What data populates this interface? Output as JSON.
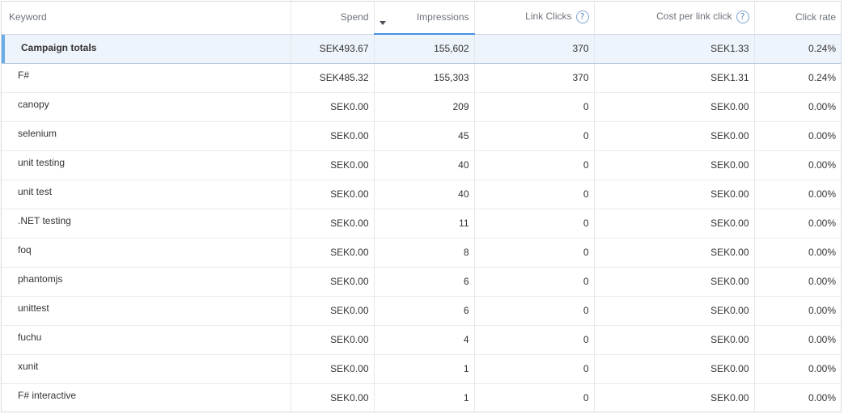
{
  "columns": {
    "keyword": "Keyword",
    "spend": "Spend",
    "impressions": "Impressions",
    "link_clicks": "Link Clicks",
    "cost_per_link_click": "Cost per link click",
    "click_rate": "Click rate"
  },
  "help_glyph": "?",
  "sorted_column": "impressions",
  "accent_color": "#4a90e2",
  "totals": {
    "keyword": "Campaign totals",
    "spend": "SEK493.67",
    "impressions": "155,602",
    "link_clicks": "370",
    "cost_per_link_click": "SEK1.33",
    "click_rate": "0.24%"
  },
  "rows": [
    {
      "keyword": "F#",
      "spend": "SEK485.32",
      "impressions": "155,303",
      "link_clicks": "370",
      "cost_per_link_click": "SEK1.31",
      "click_rate": "0.24%"
    },
    {
      "keyword": "canopy",
      "spend": "SEK0.00",
      "impressions": "209",
      "link_clicks": "0",
      "cost_per_link_click": "SEK0.00",
      "click_rate": "0.00%"
    },
    {
      "keyword": "selenium",
      "spend": "SEK0.00",
      "impressions": "45",
      "link_clicks": "0",
      "cost_per_link_click": "SEK0.00",
      "click_rate": "0.00%"
    },
    {
      "keyword": "unit testing",
      "spend": "SEK0.00",
      "impressions": "40",
      "link_clicks": "0",
      "cost_per_link_click": "SEK0.00",
      "click_rate": "0.00%"
    },
    {
      "keyword": "unit test",
      "spend": "SEK0.00",
      "impressions": "40",
      "link_clicks": "0",
      "cost_per_link_click": "SEK0.00",
      "click_rate": "0.00%"
    },
    {
      "keyword": ".NET testing",
      "spend": "SEK0.00",
      "impressions": "11",
      "link_clicks": "0",
      "cost_per_link_click": "SEK0.00",
      "click_rate": "0.00%"
    },
    {
      "keyword": "foq",
      "spend": "SEK0.00",
      "impressions": "8",
      "link_clicks": "0",
      "cost_per_link_click": "SEK0.00",
      "click_rate": "0.00%"
    },
    {
      "keyword": "phantomjs",
      "spend": "SEK0.00",
      "impressions": "6",
      "link_clicks": "0",
      "cost_per_link_click": "SEK0.00",
      "click_rate": "0.00%"
    },
    {
      "keyword": "unittest",
      "spend": "SEK0.00",
      "impressions": "6",
      "link_clicks": "0",
      "cost_per_link_click": "SEK0.00",
      "click_rate": "0.00%"
    },
    {
      "keyword": "fuchu",
      "spend": "SEK0.00",
      "impressions": "4",
      "link_clicks": "0",
      "cost_per_link_click": "SEK0.00",
      "click_rate": "0.00%"
    },
    {
      "keyword": "xunit",
      "spend": "SEK0.00",
      "impressions": "1",
      "link_clicks": "0",
      "cost_per_link_click": "SEK0.00",
      "click_rate": "0.00%"
    },
    {
      "keyword": "F# interactive",
      "spend": "SEK0.00",
      "impressions": "1",
      "link_clicks": "0",
      "cost_per_link_click": "SEK0.00",
      "click_rate": "0.00%"
    }
  ]
}
